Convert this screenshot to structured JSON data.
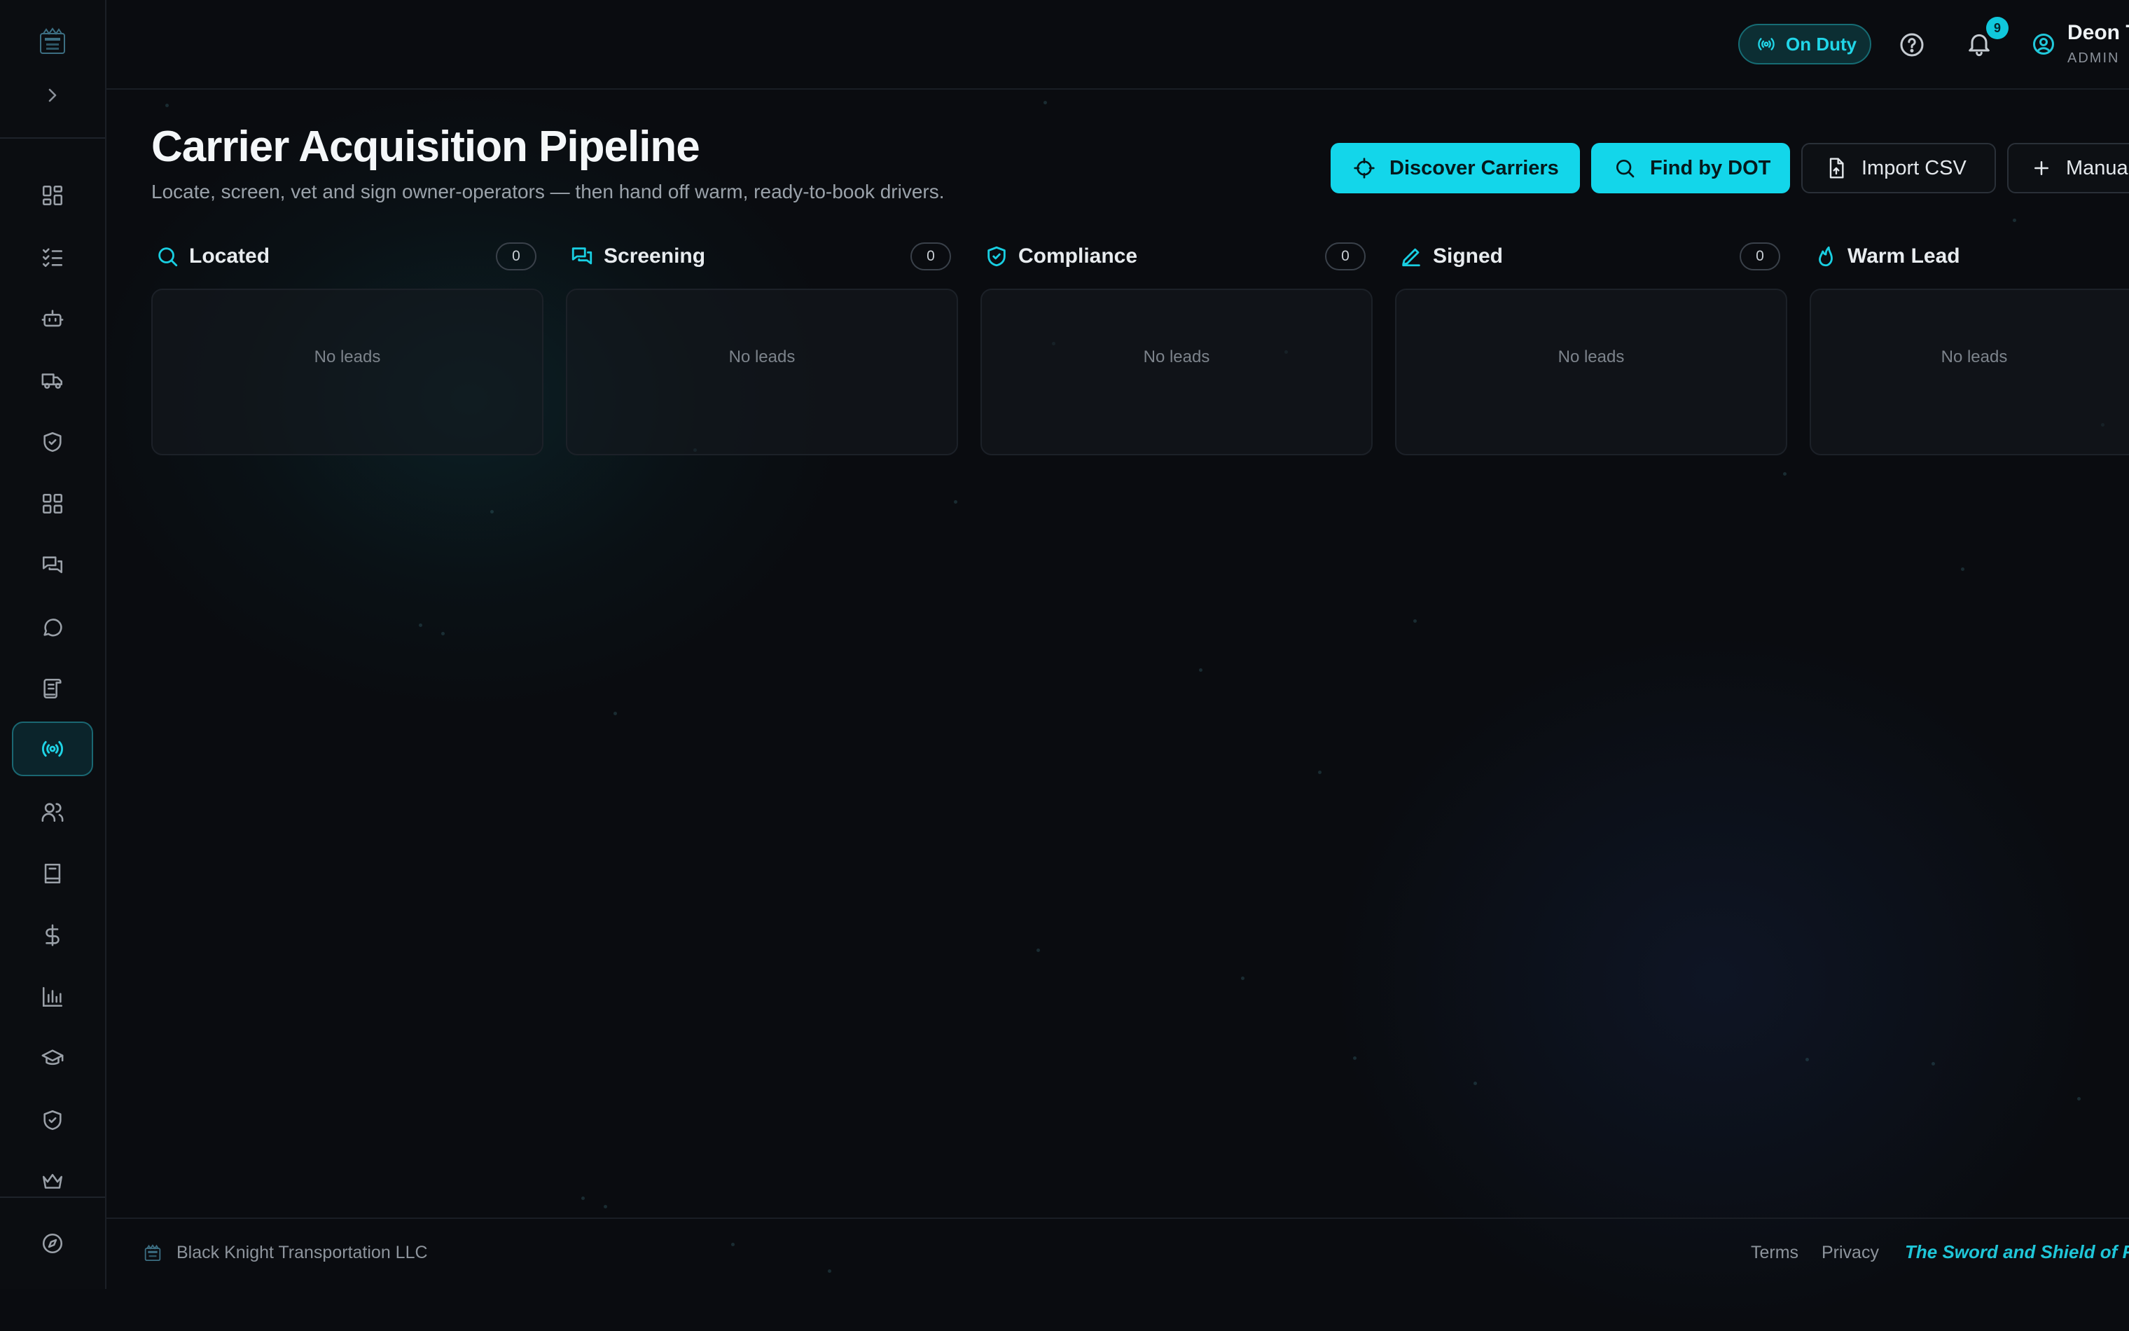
{
  "colors": {
    "accent": "#13d6ea",
    "background": "#0a0c10",
    "border": "#1c2128"
  },
  "sidebar": {
    "logo_icon": "knight-crest-logo",
    "expand_icon": "chevron-right-icon",
    "items": [
      {
        "icon": "dashboard-icon",
        "active": false
      },
      {
        "icon": "checklist-icon",
        "active": false
      },
      {
        "icon": "bot-icon",
        "active": false
      },
      {
        "icon": "truck-icon",
        "active": false
      },
      {
        "icon": "shield-check-icon",
        "active": false
      },
      {
        "icon": "grid-icon",
        "active": false
      },
      {
        "icon": "messages-icon",
        "active": false
      },
      {
        "icon": "chat-bubble-icon",
        "active": false
      },
      {
        "icon": "scroll-icon",
        "active": false
      },
      {
        "icon": "radio-broadcast-icon",
        "active": true
      },
      {
        "icon": "users-icon",
        "active": false
      },
      {
        "icon": "book-icon",
        "active": false
      },
      {
        "icon": "dollar-icon",
        "active": false
      },
      {
        "icon": "bar-chart-icon",
        "active": false
      },
      {
        "icon": "graduation-cap-icon",
        "active": false
      },
      {
        "icon": "shield-icon",
        "active": false
      },
      {
        "icon": "crown-icon",
        "active": false
      }
    ],
    "bottom_icon": "compass-icon"
  },
  "topbar": {
    "duty_status": "On Duty",
    "notification_count": "9",
    "user_name": "Deon T",
    "user_role": "ADMIN"
  },
  "page": {
    "title": "Carrier Acquisition Pipeline",
    "subtitle": "Locate, screen, vet and sign owner-operators — then hand off warm, ready-to-book drivers."
  },
  "actions": {
    "discover": "Discover Carriers",
    "find_dot": "Find by DOT",
    "import_csv": "Import CSV",
    "manual": "Manua"
  },
  "columns": [
    {
      "title": "Located",
      "count": "0",
      "empty": "No leads",
      "icon": "search-icon"
    },
    {
      "title": "Screening",
      "count": "0",
      "empty": "No leads",
      "icon": "messages-icon"
    },
    {
      "title": "Compliance",
      "count": "0",
      "empty": "No leads",
      "icon": "shield-check-icon"
    },
    {
      "title": "Signed",
      "count": "0",
      "empty": "No leads",
      "icon": "pen-icon"
    },
    {
      "title": "Warm Lead",
      "count": "",
      "empty": "No leads",
      "icon": "flame-icon"
    }
  ],
  "footer": {
    "company": "Black Knight Transportation LLC",
    "terms": "Terms",
    "privacy": "Privacy",
    "tagline": "The Sword and Shield of Fr"
  }
}
